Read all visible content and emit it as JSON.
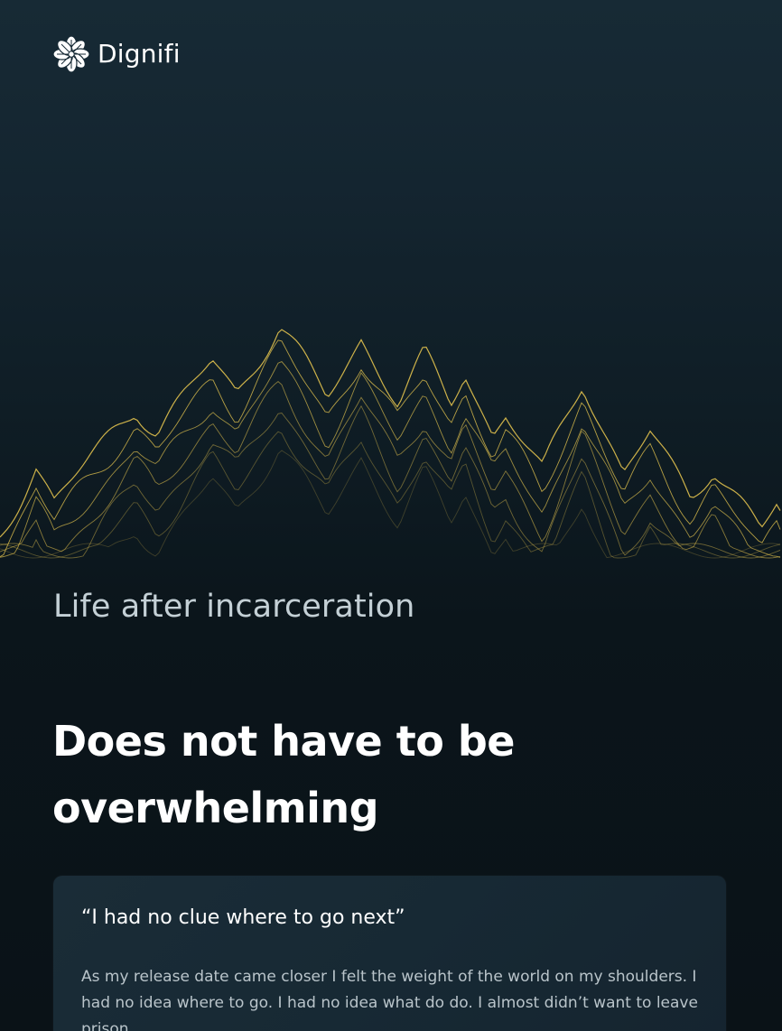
{
  "brand": {
    "name": "Dignifi",
    "logo_icon": "flower-logo-icon",
    "accent_color": "#d9b84a"
  },
  "hero": {
    "illustration": "wireframe-mountain",
    "subtitle": "Life after incarceration",
    "headline": "Does not have to be overwhelming"
  },
  "testimonial": {
    "quote": "“I had no clue where to go next”",
    "body": "As my release date came closer I felt the weight of the world on my shoulders. I had no idea where to go. I had no idea what do do. I almost didn’t want to leave prison."
  }
}
